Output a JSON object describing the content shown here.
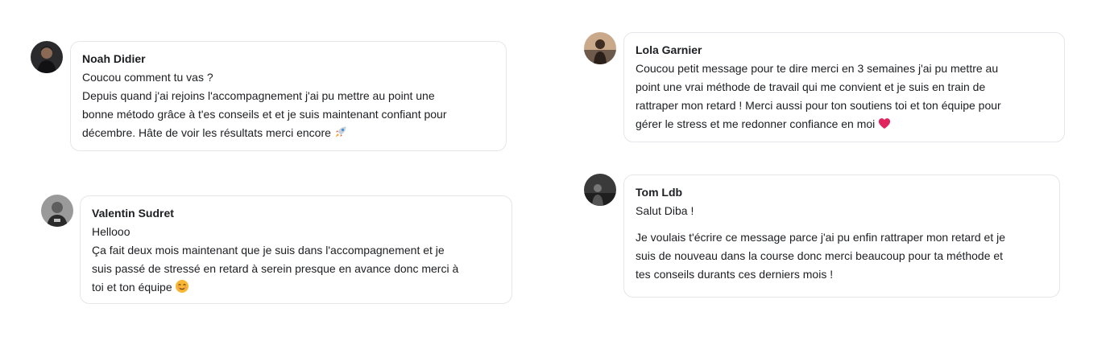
{
  "comments": [
    {
      "author": "Noah Didier",
      "lines": [
        "Coucou comment tu vas ?",
        "Depuis quand j'ai rejoins l'accompagnement j'ai pu mettre au point une",
        "bonne método grâce à t'es conseils et et je suis maintenant confiant pour",
        "décembre. Hâte de voir les résultats merci encore"
      ],
      "emoji": "rocket-icon"
    },
    {
      "author": "Valentin Sudret",
      "lines": [
        "Hellooo",
        "Ça fait deux mois maintenant que je suis dans l'accompagnement et je",
        "suis passé de stressé en retard à serein presque en avance donc merci à",
        "toi et ton équipe"
      ],
      "emoji": "relieved-face-icon"
    },
    {
      "author": "Lola Garnier",
      "lines": [
        "Coucou petit message pour te dire merci en 3 semaines j'ai pu mettre au",
        "point une vrai méthode de travail qui me convient et je suis en train de",
        "rattraper mon retard ! Merci aussi pour ton soutiens toi et ton équipe pour",
        "gérer le stress et me redonner confiance en moi"
      ],
      "emoji": "red-heart-icon"
    },
    {
      "author": "Tom Ldb",
      "lines": [
        "Salut Diba !"
      ],
      "paragraph2": [
        "Je voulais t'écrire ce message parce j'ai pu enfin rattraper mon retard et je",
        "suis de nouveau dans la course donc merci beaucoup pour ta méthode et",
        "tes conseils durants ces derniers mois !"
      ]
    }
  ],
  "colors": {
    "bubble_border": "#e4e6ea",
    "text": "#1c1e21",
    "background": "#ffffff"
  }
}
